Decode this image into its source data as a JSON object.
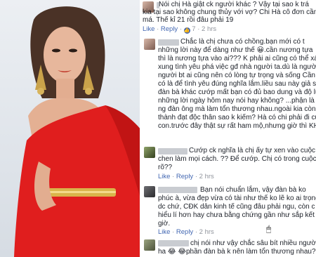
{
  "comments": [
    {
      "lines": [
        "Nói chị Hà giật ck người khác ? Vậy tại sao k trá",
        "kia tại sao không chung thủy với vợ? Chi Hà cô đơn cần chồ",
        "má. Thế kỉ 21 rồi đâu phải 19"
      ],
      "meta": {
        "like": "Like",
        "reply": "Reply",
        "likes": "7",
        "time": "2 hrs"
      }
    },
    {
      "lines": [
        "Chắc là chị chưa có chồng.bạn mới có t",
        "những lời này để dàng như thế 😀.cần nương tựa",
        "thì là nương tựa vào ai??? K phải ai cũng có thể xán",
        "xung tình yêu phá việc gđ nhà người ta.dù là người nổ",
        "người bt ai cũng nên có lòng tự trọng và sống Cần có c",
        "có là để tình yêu đúng nghĩa lắm.liều sau này giả sử ch",
        "đàn bà khác cướp mất bạn có đủ bao dung và độ lượn",
        "những lời ngày hôm nay nói hay không? ...phận là đàn",
        "ng đàn ông mà làm tổn thương nhau.ngoài kia còn đầy",
        "thành đạt độc thân sao k kiếm? Hà có chi phải đi cướp",
        "con.trước đây thật sự rất ham mộ,nhưng giờ thì KHINH"
      ]
    },
    {
      "lines": [
        "Cướp ck nghĩa là chị ấy tự xen vào cuộc sốn",
        "chen làm mọi cách. ?? Để cướp. Chị có trong cuộc hay",
        "rõ??"
      ],
      "meta": {
        "like": "Like",
        "reply": "Reply",
        "time": "2 hrs"
      }
    },
    {
      "lines": [
        "Bạn nói chuẩn lắm, vậy đàn bà ko",
        "phúc à, vừa đẹp vừa có tài như thế ko lẽ ko ai trọng à, p",
        "dc chứ, CĐK dân kinh tế cũng đâu phải ngu, còn c",
        "hiểu lí hơn hay chưa bằng chứng gần như sắp kết thúc",
        "giờ."
      ],
      "meta": {
        "like": "Like",
        "reply": "Reply",
        "time": "2 hrs"
      }
    },
    {
      "lines": [
        "chị nói như vậy chắc sâu bít nhiều người c",
        "ha 😂 😂 ... ",
        "phần đàn bà k nên làm tổn thương nhau??? Cướp"
      ]
    }
  ]
}
